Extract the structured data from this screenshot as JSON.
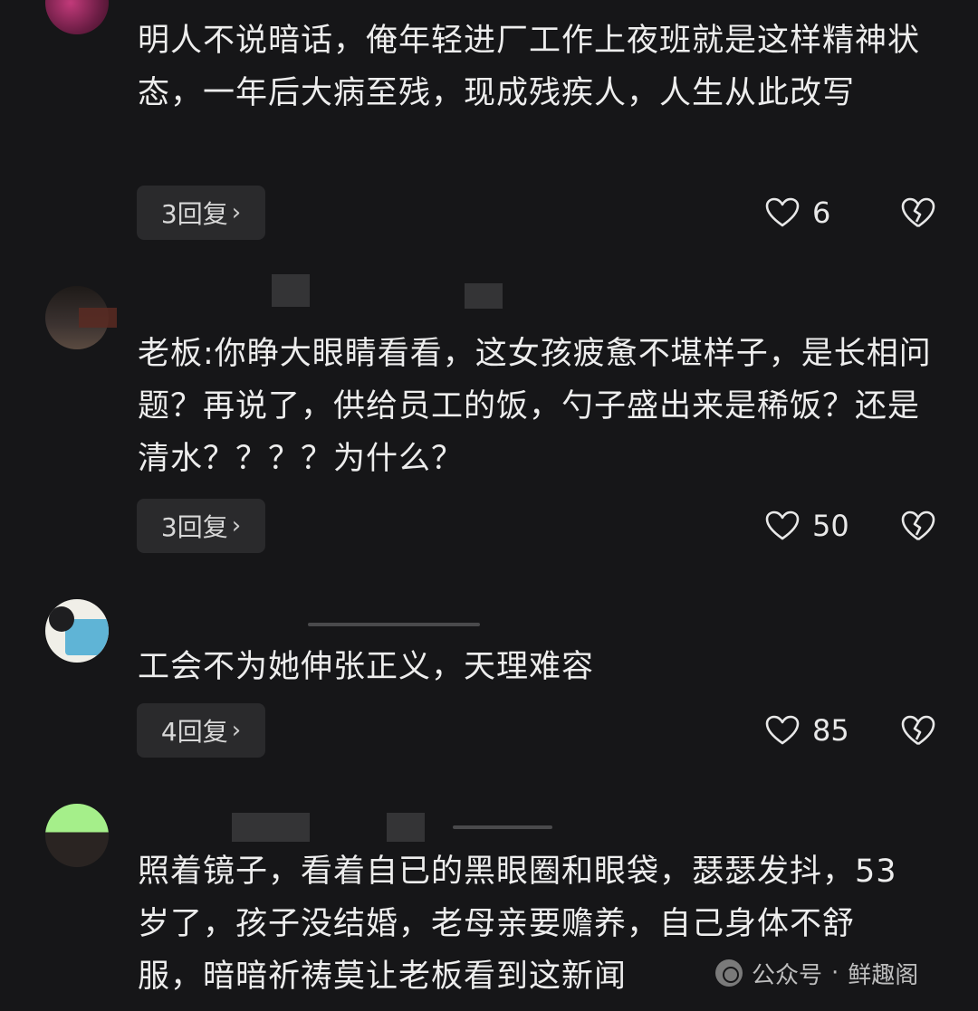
{
  "comments": [
    {
      "text": "明人不说暗话，俺年轻进厂工作上夜班就是这样精神状态，一年后大病至残，现成残疾人，人生从此改写",
      "reply_label": "3回复",
      "likes": "6"
    },
    {
      "text": "老板:你睁大眼睛看看，这女孩疲惫不堪样子，是长相问题？再说了，供给员工的饭，勺子盛出来是稀饭？还是清水？？？？为什么？",
      "reply_label": "3回复",
      "likes": "50"
    },
    {
      "text": "工会不为她伸张正义，天理难容",
      "reply_label": "4回复",
      "likes": "85"
    },
    {
      "text": "照着镜子，看着自已的黑眼圈和眼袋，瑟瑟发抖，53岁了，孩子没结婚，老母亲要赡养，自己身体不舒服，暗暗祈祷莫让老板看到这新闻"
    }
  ],
  "watermark": {
    "account_label": "公众号",
    "separator": "·",
    "account_name": "鲜趣阁"
  },
  "icons": {
    "like": "heart-outline-icon",
    "dislike": "broken-heart-icon",
    "reply_chevron": "chevron-right-icon",
    "watermark": "wechat-official-account-icon"
  },
  "colors": {
    "background": "#161618",
    "text": "#ededed",
    "reply_button_bg": "#2a2a2c"
  }
}
